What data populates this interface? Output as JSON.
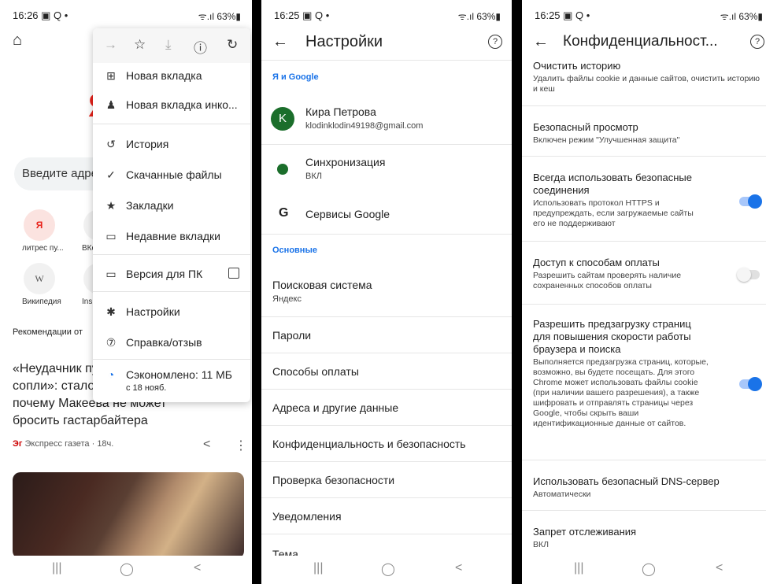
{
  "phone1": {
    "status": {
      "time": "16:26 ▣ Q •",
      "right": "ᯤ.ıl 63%▮"
    },
    "search_placeholder": "Введите адрес",
    "tiles": [
      {
        "glyph": "Я",
        "label": "литрес пу..."
      },
      {
        "glyph": "",
        "label": "ВКо"
      },
      {
        "glyph": "W",
        "label": "Википедия"
      },
      {
        "glyph": "",
        "label": "Ins"
      }
    ],
    "recommendations": "Рекомендации от",
    "news": {
      "title": "«Неудачник пу... сопли»: стало... почему Макеева не может бросить гастарбайтера",
      "title_lines": [
        "«Неудачник пу",
        "сопли»: стало",
        "почему Макеева не может",
        "бросить гастарбайтера"
      ],
      "source": "Экспресс газета · 18ч."
    },
    "menu": {
      "items": [
        {
          "icon": "plus-square-icon",
          "label": "Новая вкладка"
        },
        {
          "icon": "incognito-icon",
          "label": "Новая вкладка инко..."
        },
        {
          "icon": "history-icon",
          "label": "История"
        },
        {
          "icon": "download-icon",
          "label": "Скачанные файлы"
        },
        {
          "icon": "star-icon",
          "label": "Закладки"
        },
        {
          "icon": "recent-tabs-icon",
          "label": "Недавние вкладки"
        },
        {
          "icon": "desktop-icon",
          "label": "Версия для ПК"
        },
        {
          "icon": "gear-icon",
          "label": "Настройки"
        },
        {
          "icon": "help-icon",
          "label": "Справка/отзыв"
        }
      ],
      "savings": {
        "label": "Сэкономлено: 11 МБ",
        "since": "с 18 нояб."
      }
    }
  },
  "phone2": {
    "status": {
      "time": "16:25 ▣ Q •",
      "right": "ᯤ.ıl 63%▮"
    },
    "title": "Настройки",
    "section_google": "Я и Google",
    "account": {
      "initial": "K",
      "name": "Кира Петрова",
      "email": "klodinklodin49198@gmail.com"
    },
    "sync": {
      "label": "Синхронизация",
      "value": "ВКЛ"
    },
    "google_services": "Сервисы Google",
    "section_basic": "Основные",
    "search_engine": {
      "label": "Поисковая система",
      "value": "Яндекс"
    },
    "items": [
      "Пароли",
      "Способы оплаты",
      "Адреса и другие данные",
      "Конфиденциальность и безопасность",
      "Проверка безопасности",
      "Уведомления",
      "Тема"
    ]
  },
  "phone3": {
    "status": {
      "time": "16:25 ▣ Q •",
      "right": "ᯤ.ıl 63%▮"
    },
    "title": "Конфиденциальност...",
    "rows": [
      {
        "title": "Очистить историю",
        "sub": "Удалить файлы cookie и данные сайтов, очистить историю и кеш"
      },
      {
        "title": "Безопасный просмотр",
        "sub": "Включен режим \"Улучшенная защита\""
      },
      {
        "title": "Всегда использовать безопасные соединения",
        "sub": "Использовать протокол HTTPS и предупреждать, если загружаемые сайты его не поддерживают",
        "toggle": true
      },
      {
        "title": "Доступ к способам оплаты",
        "sub": "Разрешить сайтам проверять наличие сохраненных способов оплаты",
        "toggle": false
      },
      {
        "title": "Разрешить предзагрузку страниц для повышения скорости работы браузера и поиска",
        "sub": "Выполняется предзагрузка страниц, которые, возможно, вы будете посещать. Для этого Chrome может использовать файлы cookie (при наличии вашего разрешения), а также шифровать и отправлять страницы через Google, чтобы скрыть ваши идентификационные данные от сайтов.",
        "toggle": true
      },
      {
        "title": "Использовать безопасный DNS-сервер",
        "sub": "Автоматически"
      },
      {
        "title": "Запрет отслеживания",
        "sub": "ВКЛ"
      }
    ]
  },
  "navbar": {
    "recent": "|||",
    "home": "◯",
    "back": "<"
  }
}
